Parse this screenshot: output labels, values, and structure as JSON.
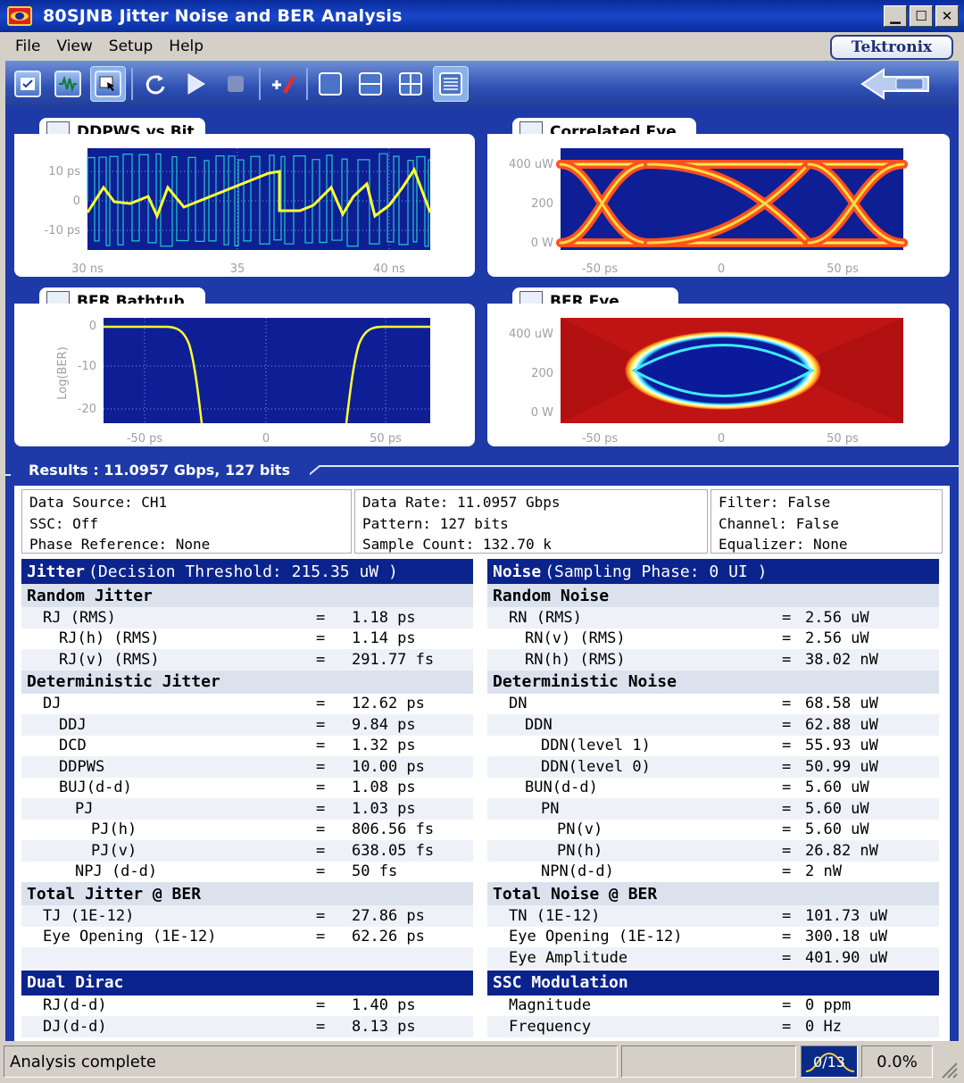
{
  "window": {
    "title": "80SJNB Jitter Noise and BER Analysis",
    "brand": "Tektronix"
  },
  "menu": [
    "File",
    "View",
    "Setup",
    "Help"
  ],
  "panels": {
    "ddpws": {
      "title": "DDPWS vs Bit",
      "y_ticks": [
        "10 ps",
        "0",
        "-10 ps"
      ],
      "x_ticks": [
        "30 ns",
        "35",
        "40 ns"
      ]
    },
    "correlated_eye": {
      "title": "Correlated Eye",
      "y_ticks": [
        "400 uW",
        "200",
        "0 W"
      ],
      "x_ticks": [
        "-50 ps",
        "0",
        "50 ps"
      ]
    },
    "bathtub": {
      "title": "BER Bathtub",
      "y_label": "Log(BER)",
      "y_ticks": [
        "0",
        "-10",
        "-20"
      ],
      "x_ticks": [
        "-50 ps",
        "0",
        "50 ps"
      ]
    },
    "ber_eye": {
      "title": "BER Eye",
      "y_ticks": [
        "400 uW",
        "200",
        "0 W"
      ],
      "x_ticks": [
        "-50 ps",
        "0",
        "50 ps"
      ]
    }
  },
  "results": {
    "tab": "Results : 11.0957 Gbps, 127 bits",
    "info": [
      [
        "Data Source: CH1",
        "SSC: Off",
        "Phase Reference: None"
      ],
      [
        "Data Rate: 11.0957 Gbps",
        "Pattern: 127 bits",
        "Sample Count: 132.70 k"
      ],
      [
        "Filter: False",
        "Channel: False",
        "Equalizer: None"
      ]
    ],
    "jitter": {
      "title": "Jitter",
      "subtitle": "(Decision Threshold: 215.35 uW )",
      "groups": [
        {
          "name": "Random Jitter",
          "rows": [
            {
              "label": "RJ (RMS)",
              "indent": 1,
              "value": "1.18 ps"
            },
            {
              "label": "RJ(h) (RMS)",
              "indent": 2,
              "value": "1.14 ps"
            },
            {
              "label": "RJ(v) (RMS)",
              "indent": 2,
              "value": "291.77 fs"
            }
          ]
        },
        {
          "name": "Deterministic Jitter",
          "rows": [
            {
              "label": "DJ",
              "indent": 1,
              "value": "12.62 ps"
            },
            {
              "label": "DDJ",
              "indent": 2,
              "value": "9.84 ps"
            },
            {
              "label": "DCD",
              "indent": 2,
              "value": "1.32 ps"
            },
            {
              "label": "DDPWS",
              "indent": 2,
              "value": "10.00 ps"
            },
            {
              "label": "BUJ(d-d)",
              "indent": 2,
              "value": "1.08 ps"
            },
            {
              "label": "PJ",
              "indent": 3,
              "value": "1.03 ps"
            },
            {
              "label": "PJ(h)",
              "indent": 4,
              "value": "806.56 fs"
            },
            {
              "label": "PJ(v)",
              "indent": 4,
              "value": "638.05 fs"
            },
            {
              "label": "NPJ (d-d)",
              "indent": 3,
              "value": "50 fs"
            }
          ]
        },
        {
          "name": "Total Jitter @ BER",
          "rows": [
            {
              "label": "TJ (1E-12)",
              "indent": 1,
              "value": "27.86 ps"
            },
            {
              "label": "Eye Opening (1E-12)",
              "indent": 1,
              "value": "62.26 ps"
            },
            {
              "label": "",
              "indent": 1,
              "value": ""
            }
          ]
        }
      ],
      "tail": {
        "title": "Dual Dirac",
        "rows": [
          {
            "label": "RJ(d-d)",
            "indent": 1,
            "value": "1.40 ps"
          },
          {
            "label": "DJ(d-d)",
            "indent": 1,
            "value": "8.13 ps"
          }
        ]
      }
    },
    "noise": {
      "title": "Noise",
      "subtitle": "(Sampling Phase: 0 UI )",
      "groups": [
        {
          "name": "Random Noise",
          "rows": [
            {
              "label": "RN (RMS)",
              "indent": 1,
              "value": "2.56 uW"
            },
            {
              "label": "RN(v) (RMS)",
              "indent": 2,
              "value": "2.56 uW"
            },
            {
              "label": "RN(h) (RMS)",
              "indent": 2,
              "value": "38.02 nW"
            }
          ]
        },
        {
          "name": "Deterministic Noise",
          "rows": [
            {
              "label": "DN",
              "indent": 1,
              "value": "68.58 uW"
            },
            {
              "label": "DDN",
              "indent": 2,
              "value": "62.88 uW"
            },
            {
              "label": "DDN(level 1)",
              "indent": 3,
              "value": "55.93 uW"
            },
            {
              "label": "DDN(level 0)",
              "indent": 3,
              "value": "50.99 uW"
            },
            {
              "label": "BUN(d-d)",
              "indent": 2,
              "value": "5.60 uW"
            },
            {
              "label": "PN",
              "indent": 3,
              "value": "5.60 uW"
            },
            {
              "label": "PN(v)",
              "indent": 4,
              "value": "5.60 uW"
            },
            {
              "label": "PN(h)",
              "indent": 4,
              "value": "26.82 nW"
            },
            {
              "label": "NPN(d-d)",
              "indent": 3,
              "value": "2 nW"
            }
          ]
        },
        {
          "name": "Total Noise @ BER",
          "rows": [
            {
              "label": "TN (1E-12)",
              "indent": 1,
              "value": "101.73 uW"
            },
            {
              "label": "Eye Opening (1E-12)",
              "indent": 1,
              "value": "300.18 uW"
            },
            {
              "label": "Eye Amplitude",
              "indent": 1,
              "value": "401.90 uW"
            }
          ]
        }
      ],
      "tail": {
        "title": "SSC Modulation",
        "rows": [
          {
            "label": "Magnitude",
            "indent": 1,
            "value": "0 ppm"
          },
          {
            "label": "Frequency",
            "indent": 1,
            "value": "0 Hz"
          }
        ]
      }
    }
  },
  "status": {
    "message": "Analysis complete",
    "percent": "0.0%",
    "indicator": "0/13"
  },
  "colors": {
    "plot_bg": "#0e1f96",
    "accent_yellow": "#ffff33",
    "header_blue": "#0b238c",
    "trace_cyan": "#22c8c8"
  }
}
